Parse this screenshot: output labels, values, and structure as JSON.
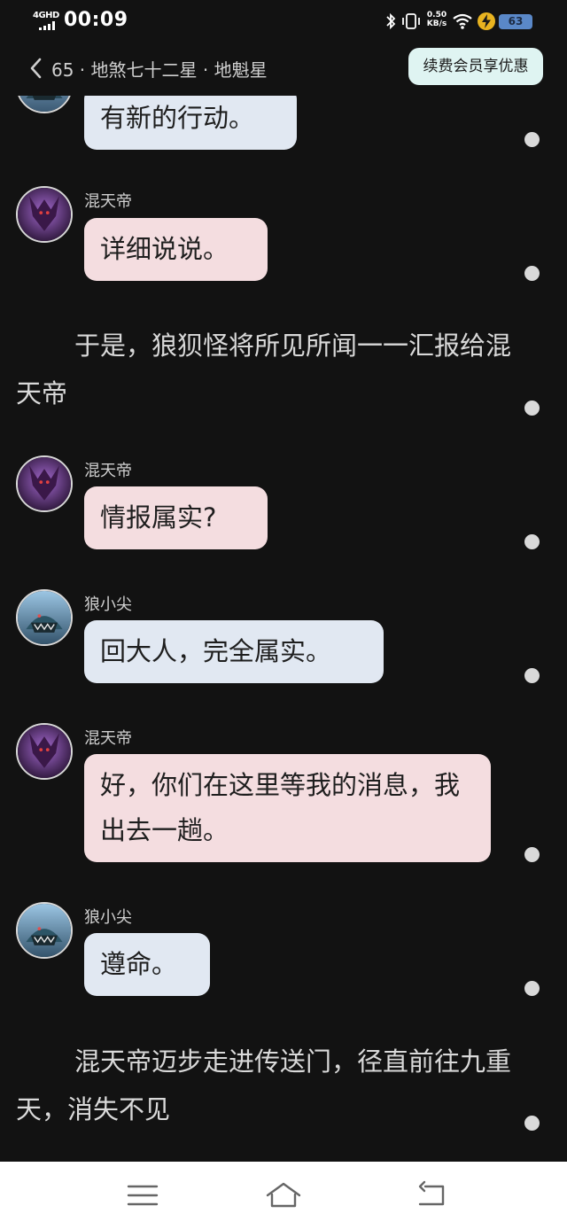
{
  "status_bar": {
    "network": "4GHD",
    "time": "00:09",
    "speed_value": "0.50",
    "speed_unit": "KB/s",
    "battery": "63"
  },
  "header": {
    "chapter_title": "65 · 地煞七十二星 · 地魁星",
    "vip_button": "续费会员享优惠",
    "back_icon": "chevron-left-icon"
  },
  "messages": [
    {
      "type": "chat",
      "speaker": "",
      "side": "blue",
      "text": "有新的行动。"
    },
    {
      "type": "chat",
      "speaker": "混天帝",
      "side": "pink",
      "text": "详细说说。"
    },
    {
      "type": "narration",
      "text": "于是，狼狈怪将所见所闻一一汇报给混天帝"
    },
    {
      "type": "chat",
      "speaker": "混天帝",
      "side": "pink",
      "text": "情报属实?"
    },
    {
      "type": "chat",
      "speaker": "狼小尖",
      "side": "blue",
      "text": "回大人，完全属实。"
    },
    {
      "type": "chat",
      "speaker": "混天帝",
      "side": "pink",
      "text": "好，你们在这里等我的消息，我出去一趟。"
    },
    {
      "type": "chat",
      "speaker": "狼小尖",
      "side": "blue",
      "text": "遵命。"
    },
    {
      "type": "narration",
      "text": "混天帝迈步走进传送门，径直前往九重天，消失不见"
    }
  ],
  "colors": {
    "background": "#121212",
    "bubble_pink": "#f4dde0",
    "bubble_blue": "#e1e8f2",
    "vip_button_bg": "#dff4f2",
    "nav_bar": "#ffffff"
  },
  "nav_bar": {
    "icons": [
      "menu-icon",
      "home-icon",
      "back-icon"
    ]
  }
}
